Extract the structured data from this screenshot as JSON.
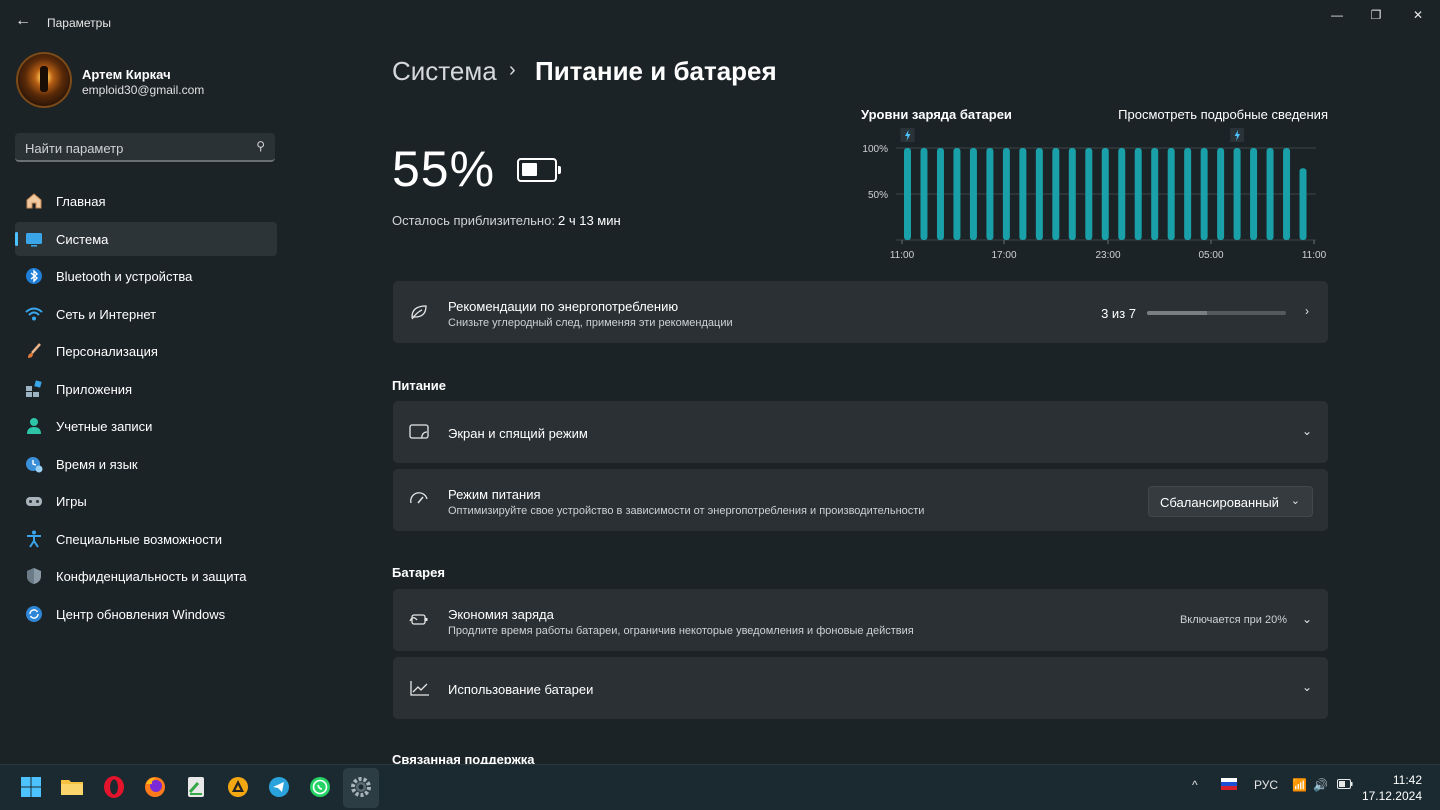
{
  "window": {
    "title": "Параметры"
  },
  "user": {
    "name": "Артем Киркач",
    "email": "emploid30@gmail.com"
  },
  "search": {
    "placeholder": "Найти параметр"
  },
  "sidebar": {
    "items": [
      {
        "label": "Главная",
        "icon": "home-icon",
        "active": false
      },
      {
        "label": "Система",
        "icon": "system-icon",
        "active": true
      },
      {
        "label": "Bluetooth и устройства",
        "icon": "bluetooth-icon",
        "active": false
      },
      {
        "label": "Сеть и Интернет",
        "icon": "wifi-icon",
        "active": false
      },
      {
        "label": "Персонализация",
        "icon": "brush-icon",
        "active": false
      },
      {
        "label": "Приложения",
        "icon": "apps-icon",
        "active": false
      },
      {
        "label": "Учетные записи",
        "icon": "account-icon",
        "active": false
      },
      {
        "label": "Время и язык",
        "icon": "time-language-icon",
        "active": false
      },
      {
        "label": "Игры",
        "icon": "gamepad-icon",
        "active": false
      },
      {
        "label": "Специальные возможности",
        "icon": "accessibility-icon",
        "active": false
      },
      {
        "label": "Конфиденциальность и защита",
        "icon": "shield-icon",
        "active": false
      },
      {
        "label": "Центр обновления Windows",
        "icon": "update-icon",
        "active": false
      }
    ]
  },
  "breadcrumb": {
    "parent": "Система",
    "separator": "›",
    "current": "Питание и батарея"
  },
  "battery": {
    "percent": "55%",
    "remaining_label": "Осталось приблизительно:",
    "remaining_value": "2 ч 13 мин",
    "level": 0.55
  },
  "chart_data": {
    "type": "bar",
    "title": "Уровни заряда батареи",
    "link": "Просмотреть подробные сведения",
    "y_ticks": [
      "100%",
      "50%"
    ],
    "x_ticks": [
      "11:00",
      "17:00",
      "23:00",
      "05:00",
      "11:00"
    ],
    "ylim": [
      0,
      100
    ],
    "values": [
      100,
      100,
      100,
      100,
      100,
      100,
      100,
      100,
      100,
      100,
      100,
      100,
      100,
      100,
      100,
      100,
      100,
      100,
      100,
      100,
      100,
      100,
      100,
      100,
      78
    ],
    "charging_markers": [
      0,
      20
    ],
    "colors": {
      "bar": "#1aa0a8",
      "accent": "#4cc2ff"
    }
  },
  "recommendations": {
    "title": "Рекомендации по энергопотреблению",
    "subtitle": "Снизьте углеродный след, применяя эти рекомендации",
    "count": "3 из 7",
    "progress": 0.43
  },
  "sections": {
    "power": "Питание",
    "battery": "Батарея",
    "support": "Связанная поддержка"
  },
  "screen_sleep": {
    "title": "Экран и спящий режим"
  },
  "power_mode": {
    "title": "Режим питания",
    "subtitle": "Оптимизируйте свое устройство в зависимости от энергопотребления и производительности",
    "value": "Сбалансированный"
  },
  "battery_saver": {
    "title": "Экономия заряда",
    "subtitle": "Продлите время работы батареи, ограничив некоторые уведомления и фоновые действия",
    "value": "Включается при 20%"
  },
  "battery_usage": {
    "title": "Использование батареи"
  },
  "taskbar": {
    "lang": "РУС",
    "time": "11:42",
    "date": "17.12.2024"
  }
}
